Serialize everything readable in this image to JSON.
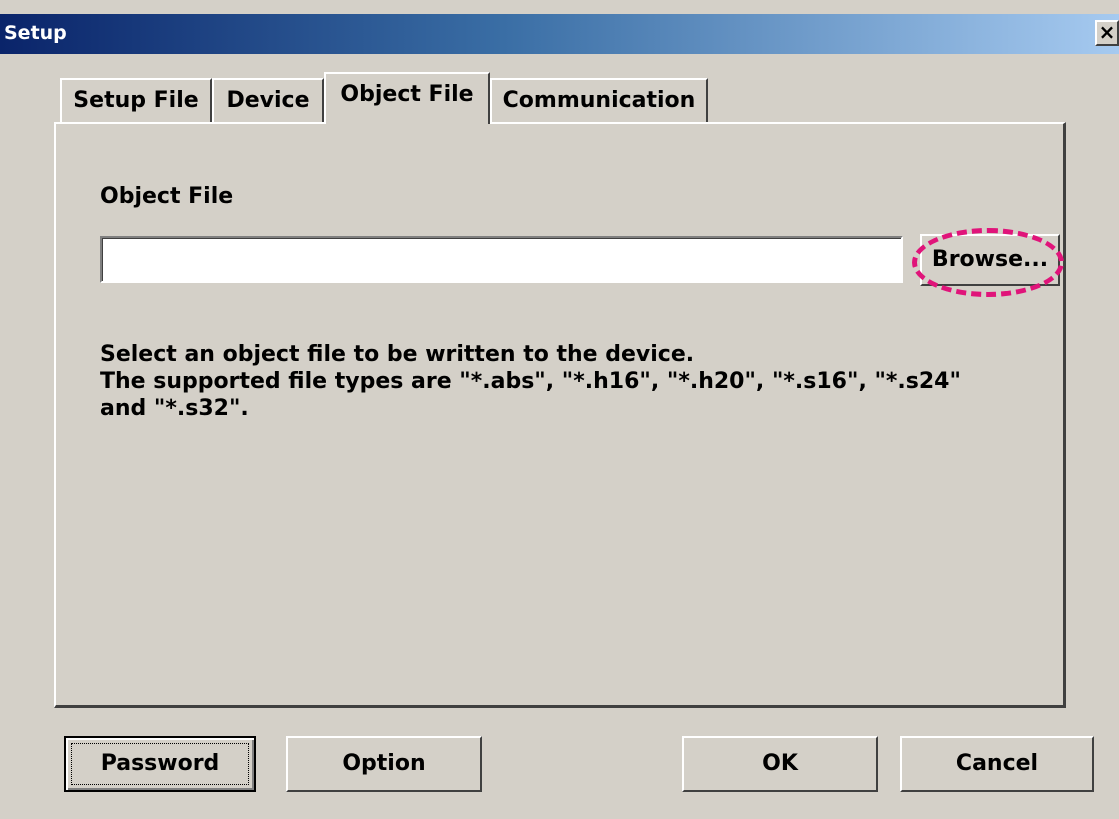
{
  "window": {
    "title": "Setup",
    "close_glyph": "×"
  },
  "tabs": [
    {
      "label": "Setup File",
      "active": false
    },
    {
      "label": "Device",
      "active": false
    },
    {
      "label": "Object File",
      "active": true
    },
    {
      "label": "Communication",
      "active": false
    }
  ],
  "object_file": {
    "label": "Object File",
    "path_value": "",
    "browse_label": "Browse...",
    "description_lines": [
      "Select an object file to be written to the device.",
      "The supported file types are \"*.abs\", \"*.h16\", \"*.h20\", \"*.s16\", \"*.s24\"",
      "and \"*.s32\"."
    ]
  },
  "buttons": {
    "password": "Password",
    "option": "Option",
    "ok": "OK",
    "cancel": "Cancel"
  },
  "colors": {
    "highlight": "#e0147a",
    "dialog_bg": "#d4d0c8",
    "title_start": "#0a246a",
    "title_end": "#a6caf0"
  }
}
